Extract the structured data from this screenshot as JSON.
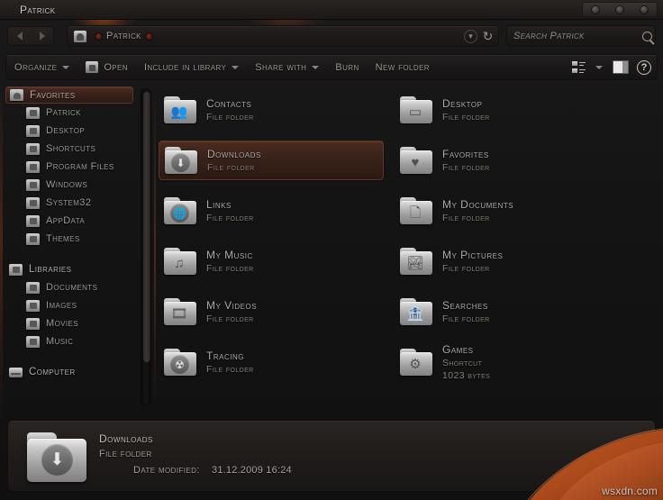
{
  "window": {
    "title": "Patrick",
    "controls": [
      "minimize-button",
      "maximize-button",
      "close-button"
    ]
  },
  "nav": {
    "back_label": "Back",
    "forward_label": "Forward",
    "breadcrumb": {
      "icon": "user-folder-icon",
      "label": "Patrick"
    },
    "history_icon": "chevron-down-icon",
    "refresh_icon": "refresh-icon"
  },
  "search": {
    "placeholder": "Search Patrick",
    "value": "",
    "icon": "search-icon"
  },
  "toolbar": {
    "items": [
      {
        "label": "Organize",
        "caret": true,
        "icon": null
      },
      {
        "label": "Open",
        "caret": false,
        "icon": "open-folder-icon"
      },
      {
        "label": "Include in library",
        "caret": true,
        "icon": null
      },
      {
        "label": "Share with",
        "caret": true,
        "icon": null
      },
      {
        "label": "Burn",
        "caret": false,
        "icon": null
      },
      {
        "label": "New folder",
        "caret": false,
        "icon": null
      }
    ],
    "views_icon": "view-options-icon",
    "views_caret": "chevron-down-icon",
    "preview_pane_icon": "preview-pane-icon",
    "help_icon": "help-icon",
    "help_glyph": "?"
  },
  "sidebar": {
    "groups": [
      {
        "header": {
          "label": "Favorites",
          "icon": "favorites-folder-icon",
          "selected": true
        },
        "items": [
          {
            "label": "Patrick",
            "icon": "user-folder-icon"
          },
          {
            "label": "Desktop",
            "icon": "desktop-folder-icon"
          },
          {
            "label": "Shortcuts",
            "icon": "shortcuts-folder-icon"
          },
          {
            "label": "Program Files",
            "icon": "program-files-folder-icon"
          },
          {
            "label": "Windows",
            "icon": "windows-folder-icon"
          },
          {
            "label": "System32",
            "icon": "system32-folder-icon"
          },
          {
            "label": "AppData",
            "icon": "appdata-folder-icon"
          },
          {
            "label": "Themes",
            "icon": "themes-folder-icon"
          }
        ]
      },
      {
        "header": {
          "label": "Libraries",
          "icon": "libraries-folder-icon",
          "selected": false
        },
        "items": [
          {
            "label": "Documents",
            "icon": "documents-folder-icon"
          },
          {
            "label": "Images",
            "icon": "images-folder-icon"
          },
          {
            "label": "Movies",
            "icon": "movies-folder-icon"
          },
          {
            "label": "Music",
            "icon": "music-folder-icon"
          }
        ]
      },
      {
        "header": {
          "label": "Computer",
          "icon": "computer-icon",
          "selected": false
        },
        "items": []
      }
    ],
    "scrollbar": "sidebar-scrollbar"
  },
  "content": {
    "items": [
      {
        "name": "Contacts",
        "type": "File folder",
        "size": "",
        "icon": "contacts-folder-icon",
        "glyph": "👥",
        "round": false,
        "selected": false,
        "col": 0,
        "row": 0
      },
      {
        "name": "Desktop",
        "type": "File folder",
        "size": "",
        "icon": "desktop-folder-icon",
        "glyph": "▭",
        "round": false,
        "selected": false,
        "col": 1,
        "row": 0
      },
      {
        "name": "Downloads",
        "type": "File folder",
        "size": "",
        "icon": "downloads-folder-icon",
        "glyph": "⬇",
        "round": true,
        "selected": true,
        "col": 0,
        "row": 1
      },
      {
        "name": "Favorites",
        "type": "File folder",
        "size": "",
        "icon": "favorites-folder-icon",
        "glyph": "♥",
        "round": false,
        "selected": false,
        "col": 1,
        "row": 1
      },
      {
        "name": "Links",
        "type": "File folder",
        "size": "",
        "icon": "links-folder-icon",
        "glyph": "🌐",
        "round": true,
        "selected": false,
        "col": 0,
        "row": 2
      },
      {
        "name": "My Documents",
        "type": "File folder",
        "size": "",
        "icon": "documents-folder-icon",
        "glyph": "🗋",
        "round": false,
        "selected": false,
        "col": 1,
        "row": 2
      },
      {
        "name": "My Music",
        "type": "File folder",
        "size": "",
        "icon": "music-folder-icon",
        "glyph": "♫",
        "round": false,
        "selected": false,
        "col": 0,
        "row": 3
      },
      {
        "name": "My Pictures",
        "type": "File folder",
        "size": "",
        "icon": "pictures-folder-icon",
        "glyph": "🏞",
        "round": false,
        "selected": false,
        "col": 1,
        "row": 3
      },
      {
        "name": "My Videos",
        "type": "File folder",
        "size": "",
        "icon": "videos-folder-icon",
        "glyph": "🎞",
        "round": false,
        "selected": false,
        "col": 0,
        "row": 4
      },
      {
        "name": "Searches",
        "type": "File folder",
        "size": "",
        "icon": "searches-folder-icon",
        "glyph": "🏦",
        "round": false,
        "selected": false,
        "col": 1,
        "row": 4
      },
      {
        "name": "Tracing",
        "type": "File folder",
        "size": "",
        "icon": "tracing-folder-icon",
        "glyph": "☢",
        "round": true,
        "selected": false,
        "col": 0,
        "row": 5
      },
      {
        "name": "Games",
        "type": "Shortcut",
        "size": "1023 bytes",
        "icon": "games-folder-icon",
        "glyph": "⚙",
        "round": false,
        "selected": false,
        "col": 1,
        "row": 5
      }
    ]
  },
  "details": {
    "icon": "downloads-folder-icon",
    "name": "Downloads",
    "type": "File folder",
    "date_label": "Date modified:",
    "date_value": "31.12.2009 16:24"
  },
  "watermark": {
    "text": "wsxdn.com"
  },
  "colors": {
    "accent": "#c4561e",
    "selection": "#4b2c20",
    "window_bg": "#151313",
    "text": "#a8a29d"
  }
}
